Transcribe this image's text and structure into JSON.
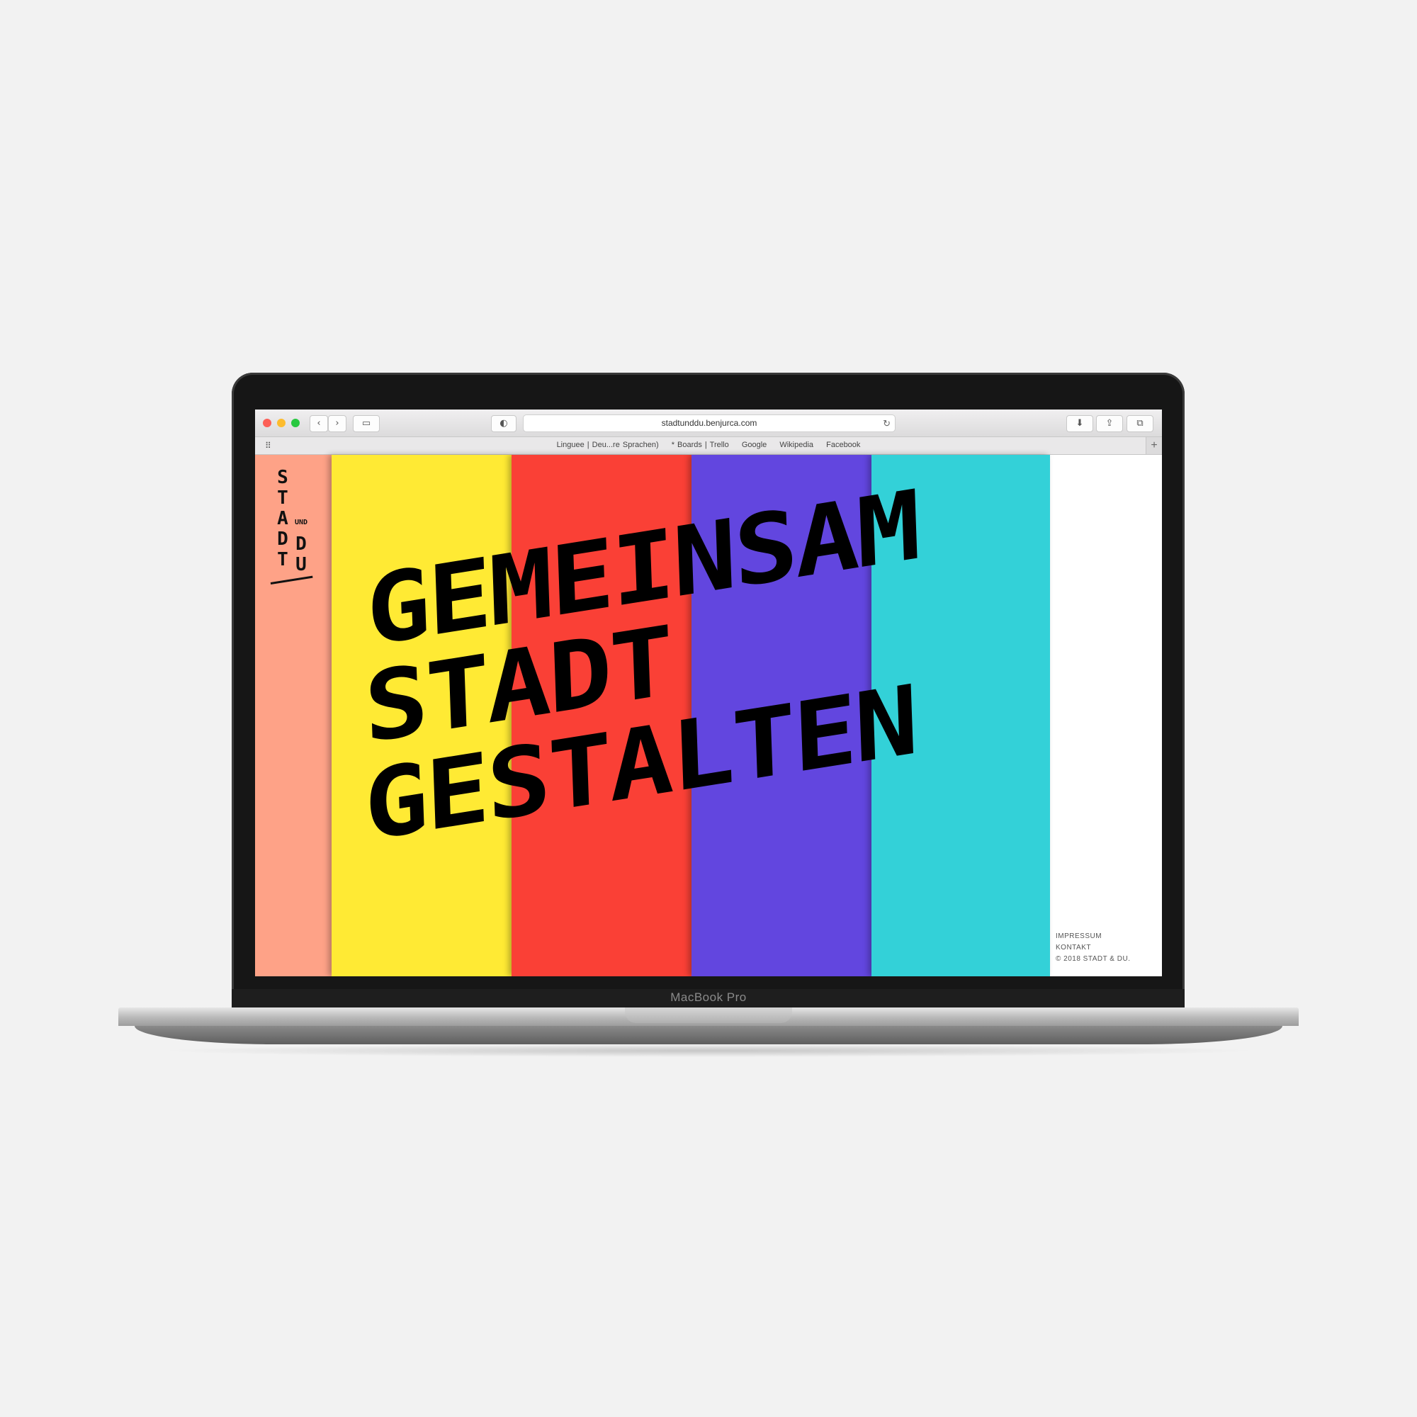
{
  "device": {
    "model_label": "MacBook Pro"
  },
  "browser": {
    "address": "stadtunddu.benjurca.com",
    "bookmarks": [
      "Linguee | Deu...re Sprachen)",
      "* Boards | Trello",
      "Google",
      "Wikipedia",
      "Facebook"
    ],
    "icons": {
      "back": "‹",
      "forward": "›",
      "sidebar": "▭",
      "shield": "◐",
      "reload": "↻",
      "download": "⬇",
      "share": "⇪",
      "tabs": "⧉",
      "grid": "⠿",
      "plus": "+"
    }
  },
  "logo": {
    "stadt": "STADT",
    "und": "UND",
    "du": "DU"
  },
  "headline": {
    "line1": "GEMEINSAM",
    "line2": "STADT",
    "line3": "GESTALTEN"
  },
  "footer": {
    "impressum": "IMPRESSUM",
    "kontakt": "KONTAKT",
    "copyright": "© 2018 STADT & DU."
  },
  "colors": {
    "salmon": "#fea287",
    "yellow": "#ffea34",
    "red": "#fa4036",
    "purple": "#6246df",
    "cyan": "#33d1d8"
  }
}
